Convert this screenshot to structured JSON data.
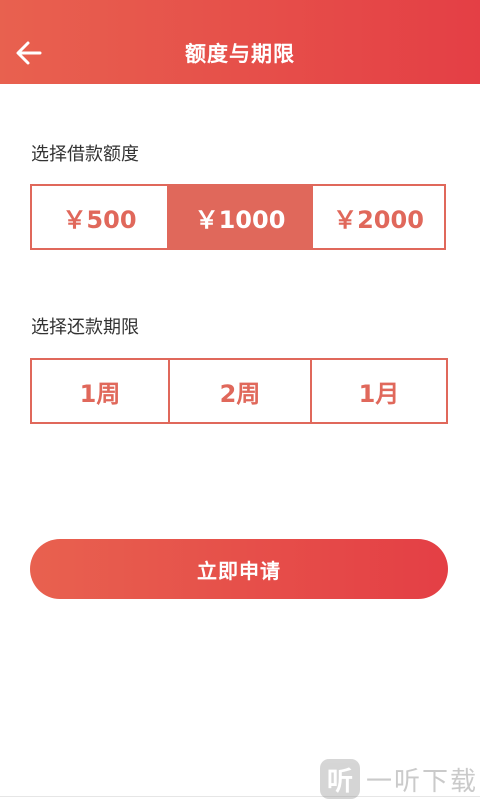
{
  "header": {
    "title": "额度与期限",
    "back_icon": "arrow-left-icon",
    "gradient_start": "#e8614f",
    "gradient_end": "#e43f45"
  },
  "amount": {
    "label": "选择借款额度",
    "options": [
      "￥500",
      "￥1000",
      "￥2000"
    ],
    "selected": "￥1000"
  },
  "term": {
    "label": "选择还款期限",
    "options": [
      "1周",
      "2周",
      "1月"
    ],
    "selected": null
  },
  "apply_button": {
    "label": "立即申请"
  },
  "watermark": {
    "logo_glyph": "听",
    "text": "一听下载"
  },
  "colors": {
    "accent": "#e0685b",
    "text": "#333333"
  }
}
